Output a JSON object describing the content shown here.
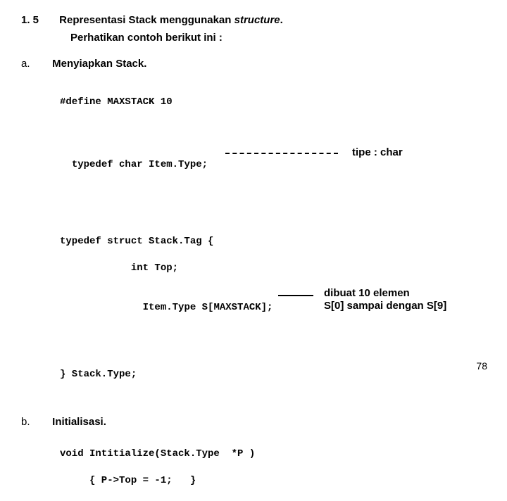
{
  "section": {
    "number": "1. 5",
    "title_pre": "Representasi Stack menggunakan ",
    "title_em": "structure",
    "title_post": ".",
    "subtitle": "Perhatikan contoh berikut ini :"
  },
  "a": {
    "label": "a.",
    "title": "Menyiapkan Stack.",
    "code_line1": "#define MAXSTACK 10",
    "code_line2": "typedef char Item.Type;",
    "code_line3": "typedef struct Stack.Tag {",
    "code_line4": "            int Top;",
    "code_line5": "            Item.Type S[MAXSTACK];",
    "code_line6": "} Stack.Type;",
    "annot1": "tipe : char",
    "annot2_line1": "dibuat 10 elemen",
    "annot2_line2": "S[0] sampai dengan S[9]"
  },
  "b": {
    "label": "b.",
    "title": "Initialisasi.",
    "code_line1": "void Intitialize(Stack.Type  *P )",
    "code_line2": "     { P->Top = -1;   }"
  },
  "page_number": "78"
}
